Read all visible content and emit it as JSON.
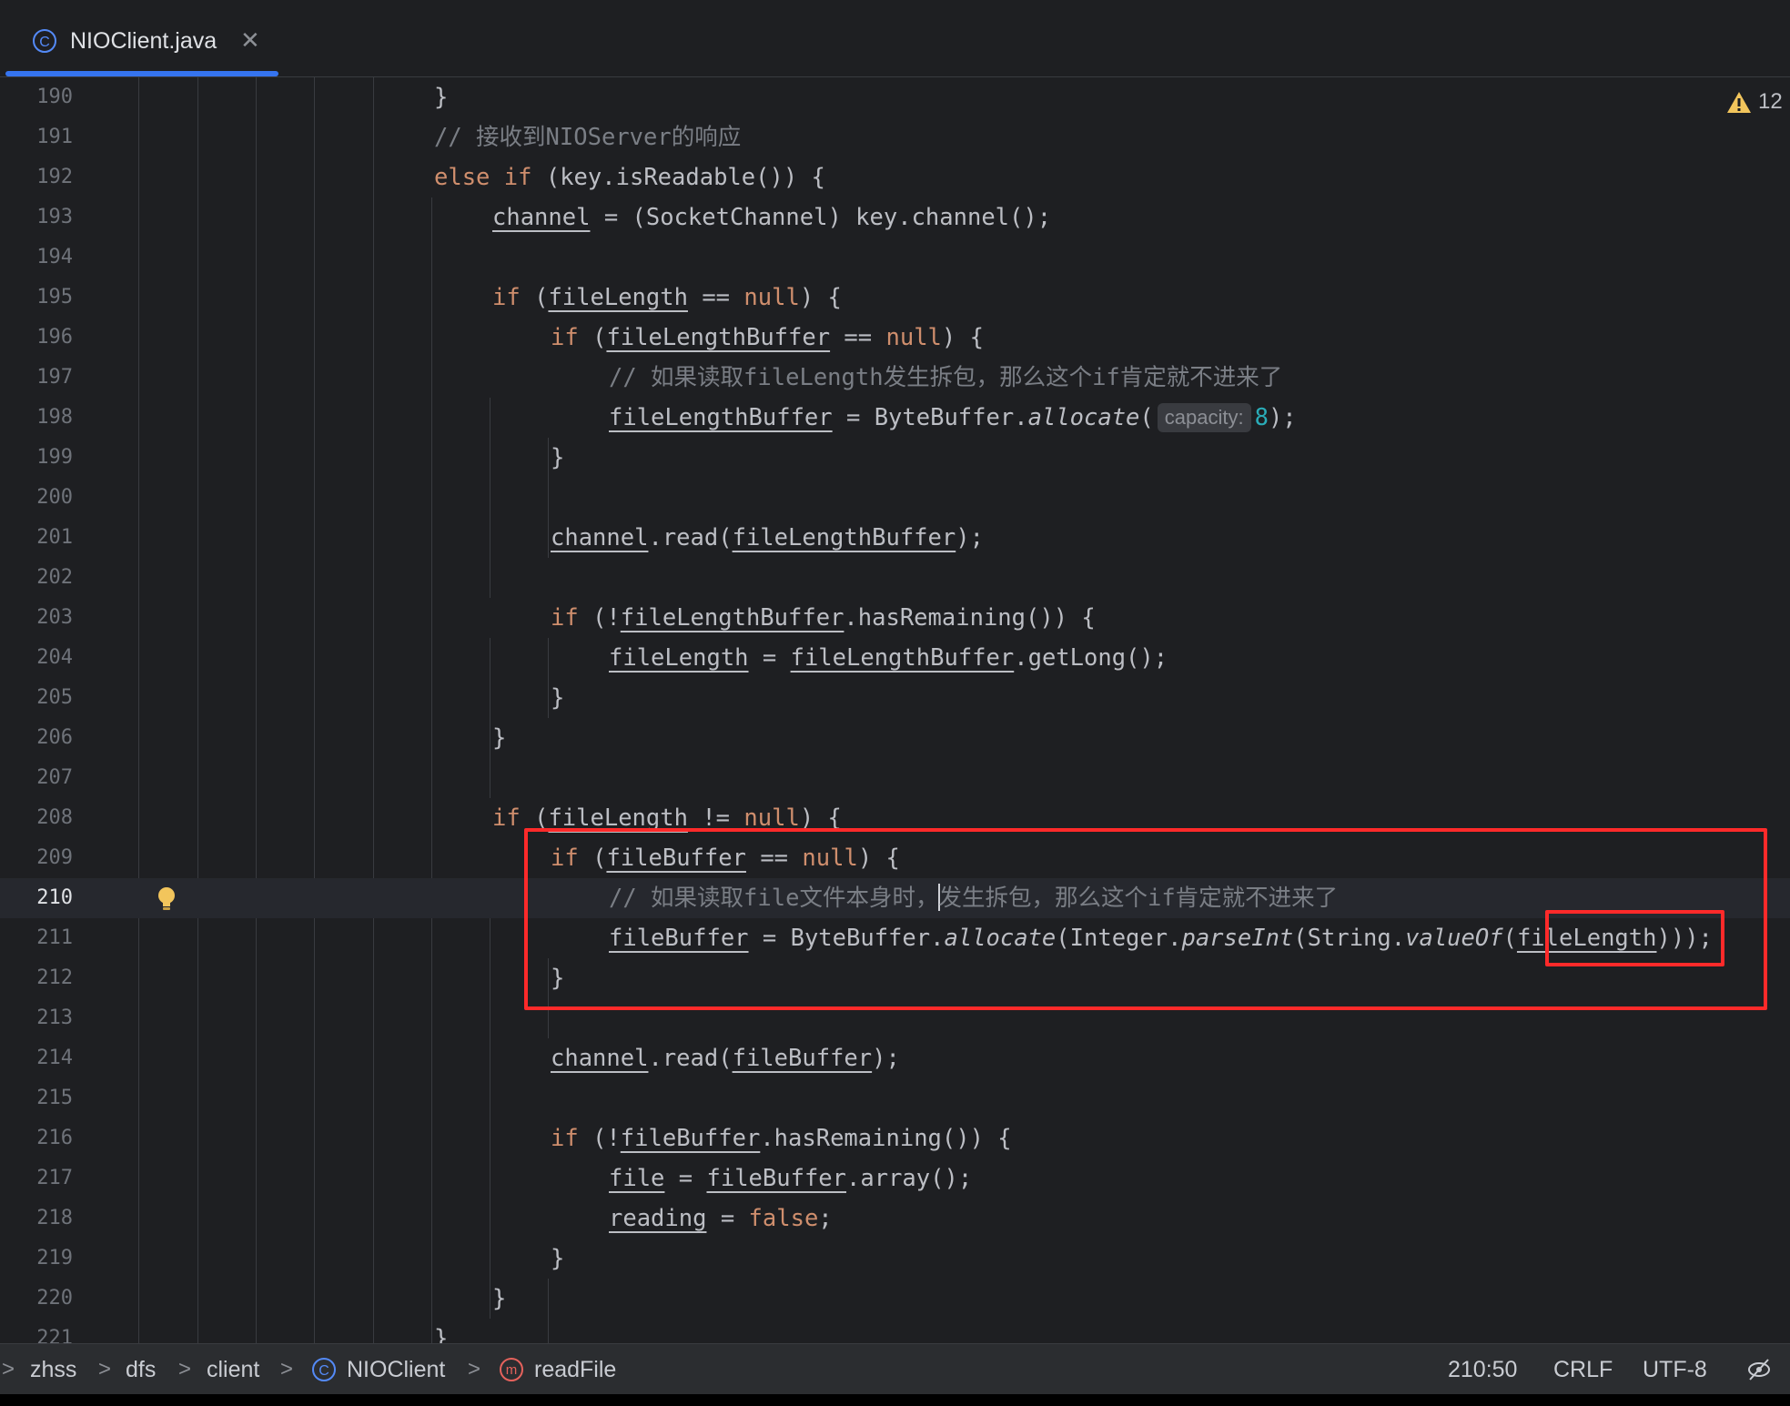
{
  "tab": {
    "label": "NIOClient.java",
    "close": "✕"
  },
  "editor": {
    "warnings_count": "12",
    "hint_label": "capacity:",
    "lines": [
      {
        "n": "190"
      },
      {
        "n": "191"
      },
      {
        "n": "192"
      },
      {
        "n": "193"
      },
      {
        "n": "194"
      },
      {
        "n": "195"
      },
      {
        "n": "196"
      },
      {
        "n": "197"
      },
      {
        "n": "198"
      },
      {
        "n": "199"
      },
      {
        "n": "200"
      },
      {
        "n": "201"
      },
      {
        "n": "202"
      },
      {
        "n": "203"
      },
      {
        "n": "204"
      },
      {
        "n": "205"
      },
      {
        "n": "206"
      },
      {
        "n": "207"
      },
      {
        "n": "208"
      },
      {
        "n": "209"
      },
      {
        "n": "210"
      },
      {
        "n": "211"
      },
      {
        "n": "212"
      },
      {
        "n": "213"
      },
      {
        "n": "214"
      },
      {
        "n": "215"
      },
      {
        "n": "216"
      },
      {
        "n": "217"
      },
      {
        "n": "218"
      },
      {
        "n": "219"
      },
      {
        "n": "220"
      },
      {
        "n": "221"
      }
    ],
    "tokens": {
      "close_brace": "}",
      "comment_191": "// 接收到NIOServer的响应",
      "else": "else",
      "if": "if",
      "null": "null",
      "false": "false",
      "is_readable": " (key.isReadable()) {",
      "channel": "channel",
      "eq_socket": " = (SocketChannel) key.channel();",
      "open_paren": " (",
      "fileLength": "fileLength",
      "fileLengthBuffer": "fileLengthBuffer",
      "fileBuffer": "fileBuffer",
      "eq_eq": " == ",
      "neq": " != ",
      "close_open_brace": ") {",
      "comment_197": "// 如果读取fileLength发生拆包，那么这个if肯定就不进来了",
      "eq_bytebuffer": " = ByteBuffer.",
      "allocate": "allocate",
      "open_p": "(",
      "eight": "8",
      "close_semi": ");",
      "dot_read_open": ".read(",
      "not_open": " (!",
      "has_remaining": ".hasRemaining()) {",
      "eq_space": " = ",
      "get_long": ".getLong();",
      "comment_210_a": "// 如果读取file文件本身时，",
      "comment_210_b": "发生拆包，那么这个if肯定就不进来了",
      "integer_dot": "(Integer.",
      "parse_int": "parseInt",
      "string_dot": "(String.",
      "value_of": "valueOf",
      "close_triple": ")));",
      "file": "file",
      "reading": "reading",
      "array": ".array();",
      "semi": ";"
    }
  },
  "statusbar": {
    "breadcrumbs": [
      "zhss",
      "dfs",
      "client",
      "NIOClient",
      "readFile"
    ],
    "sep": ">",
    "position": "210:50",
    "line_separator": "CRLF",
    "encoding": "UTF-8"
  },
  "colors": {
    "accent": "#3574f0",
    "highlight_box": "#ff2a2a",
    "keyword": "#cf8e6d",
    "comment": "#7a7e85",
    "number": "#2aacb8"
  }
}
